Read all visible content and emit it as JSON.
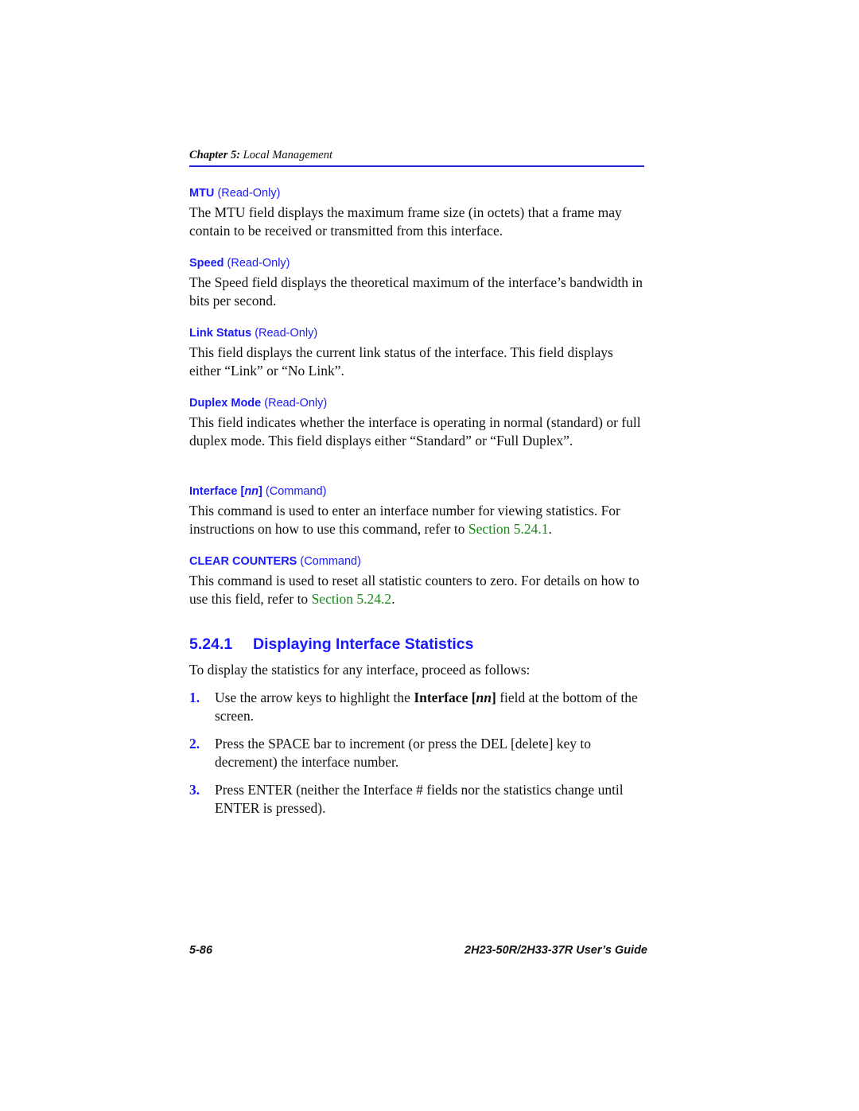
{
  "header": {
    "chapter_label": "Chapter 5:",
    "chapter_title": " Local Management"
  },
  "fields": [
    {
      "name": "MTU",
      "type": "(Read-Only)",
      "description": "The MTU field displays the maximum frame size (in octets) that a frame may contain to be received or transmitted from this interface."
    },
    {
      "name": "Speed",
      "type": "(Read-Only)",
      "description": "The Speed field displays the theoretical maximum of the interface’s bandwidth in bits per second."
    },
    {
      "name": "Link Status",
      "type": "(Read-Only)",
      "description": "This field displays the current link status of the interface. This field displays either “Link” or “No Link”."
    },
    {
      "name": "Duplex Mode",
      "type": "(Read-Only)",
      "description": "This field indicates whether the interface is operating in normal (standard) or full duplex mode. This field displays either “Standard” or “Full Duplex”."
    },
    {
      "name": "Interface [",
      "name_italic": "nn",
      "name_end": "]",
      "type": "(Command)",
      "description": "This command is used to enter an interface number for viewing statistics. For instructions on how to use this command, refer to ",
      "link": "Section 5.24.1",
      "description_end": "."
    },
    {
      "name": "CLEAR COUNTERS",
      "type": "(Command)",
      "description": "This command is used to reset all statistic counters to zero. For details on how to use this field, refer to ",
      "link": "Section 5.24.2",
      "description_end": "."
    }
  ],
  "section": {
    "number": "5.24.1",
    "title": "Displaying Interface Statistics",
    "intro": "To display the statistics for any interface, proceed as follows:",
    "steps": [
      {
        "number": "1.",
        "pre": "Use the arrow keys to highlight the ",
        "bold": "Interface [",
        "bold_italic": "nn",
        "bold_end": "]",
        "post": " field at the bottom of the screen."
      },
      {
        "number": "2.",
        "text": "Press the SPACE bar to increment (or press the DEL [delete] key to decrement) the interface number."
      },
      {
        "number": "3.",
        "text": "Press ENTER (neither the Interface # fields nor the statistics change until ENTER is pressed)."
      }
    ]
  },
  "footer": {
    "page_number": "5-86",
    "guide_title": "2H23-50R/2H33-37R User’s Guide"
  }
}
